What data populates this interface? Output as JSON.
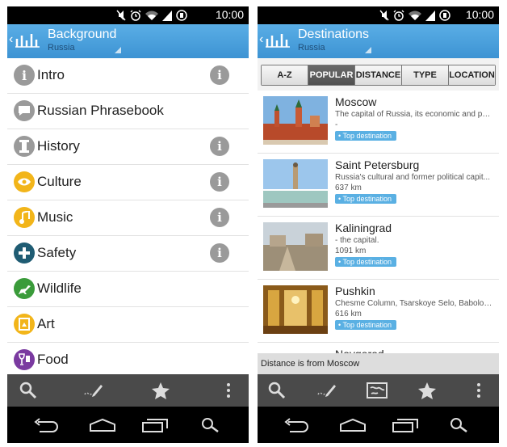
{
  "status": {
    "time": "10:00"
  },
  "left": {
    "actionbar": {
      "title": "Background",
      "subtitle": "Russia"
    },
    "items": [
      {
        "label": "Intro",
        "icon": "intro-icon",
        "color": "#9a9a9a",
        "info": true
      },
      {
        "label": "Russian Phrasebook",
        "icon": "speech-bubble-icon",
        "color": "#9a9a9a",
        "info": false
      },
      {
        "label": "History",
        "icon": "column-icon",
        "color": "#9a9a9a",
        "info": true
      },
      {
        "label": "Culture",
        "icon": "eye-icon",
        "color": "#f2b51a",
        "info": true
      },
      {
        "label": "Music",
        "icon": "music-note-icon",
        "color": "#f2b51a",
        "info": true
      },
      {
        "label": "Safety",
        "icon": "cross-icon",
        "color": "#1f5c73",
        "info": true
      },
      {
        "label": "Wildlife",
        "icon": "deer-icon",
        "color": "#3a9b3a",
        "info": false
      },
      {
        "label": "Art",
        "icon": "frame-icon",
        "color": "#f2b51a",
        "info": false
      },
      {
        "label": "Food",
        "icon": "wine-glass-icon",
        "color": "#7a3aa0",
        "info": false
      }
    ]
  },
  "right": {
    "actionbar": {
      "title": "Destinations",
      "subtitle": "Russia"
    },
    "tabs": [
      "A-Z",
      "POPULAR",
      "DISTANCE",
      "TYPE",
      "LOCATION"
    ],
    "active_tab": "POPULAR",
    "destinations": [
      {
        "name": "Moscow",
        "desc": "The capital of Russia, its economic and po...",
        "distance": "-",
        "badge": "Top destination"
      },
      {
        "name": "Saint Petersburg",
        "desc": "Russia's cultural and former political capit...",
        "distance": "637 km",
        "badge": "Top destination"
      },
      {
        "name": "Kaliningrad",
        "desc": "- the capital.",
        "distance": "1091 km",
        "badge": "Top destination"
      },
      {
        "name": "Pushkin",
        "desc": "Chesme Column, Tsarskoye Selo, Babolov...",
        "distance": "616 km",
        "badge": "Top destination"
      },
      {
        "name": "Novgorod",
        "desc": "",
        "distance": "",
        "badge": ""
      }
    ],
    "footer_note": "Distance is from Moscow"
  },
  "colors": {
    "actionbar": "#4aa3df",
    "badge": "#5ab0e3",
    "info": "#9a9a9a"
  }
}
